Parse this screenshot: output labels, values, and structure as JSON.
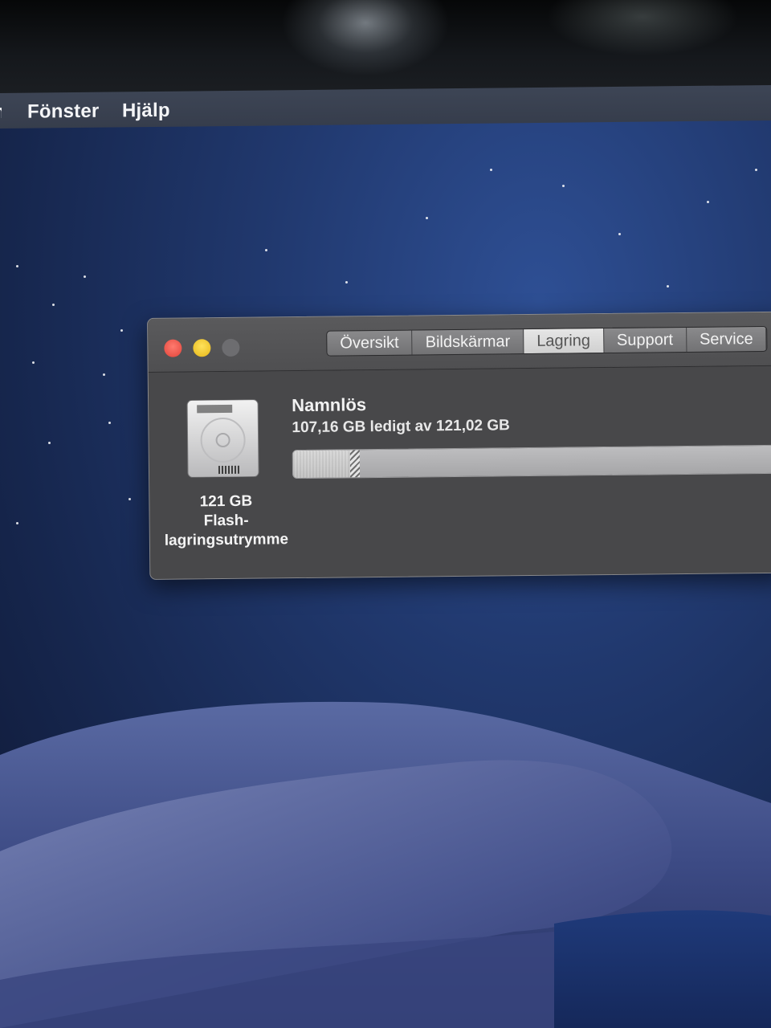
{
  "menubar": {
    "items": [
      {
        "label": "Fönster"
      },
      {
        "label": "Hjälp"
      }
    ]
  },
  "window": {
    "traffic_lights": [
      "close",
      "minimize",
      "zoom"
    ],
    "tabs": [
      {
        "label": "Översikt",
        "selected": false
      },
      {
        "label": "Bildskärmar",
        "selected": false
      },
      {
        "label": "Lagring",
        "selected": true
      },
      {
        "label": "Support",
        "selected": false
      },
      {
        "label": "Service",
        "selected": false
      }
    ],
    "drive": {
      "icon": "hard-drive-icon",
      "label_line1": "121 GB",
      "label_line2": "Flash-",
      "label_line3": "lagringsutrymme"
    },
    "volume": {
      "name": "Namnlös",
      "free_text": "107,16 GB ledigt av 121,02 GB",
      "used_fraction": 0.115
    }
  },
  "colors": {
    "close": "#e0443a",
    "minimize": "#e6b619",
    "zoom": "#6d6d70",
    "desktop": "#21396f"
  }
}
